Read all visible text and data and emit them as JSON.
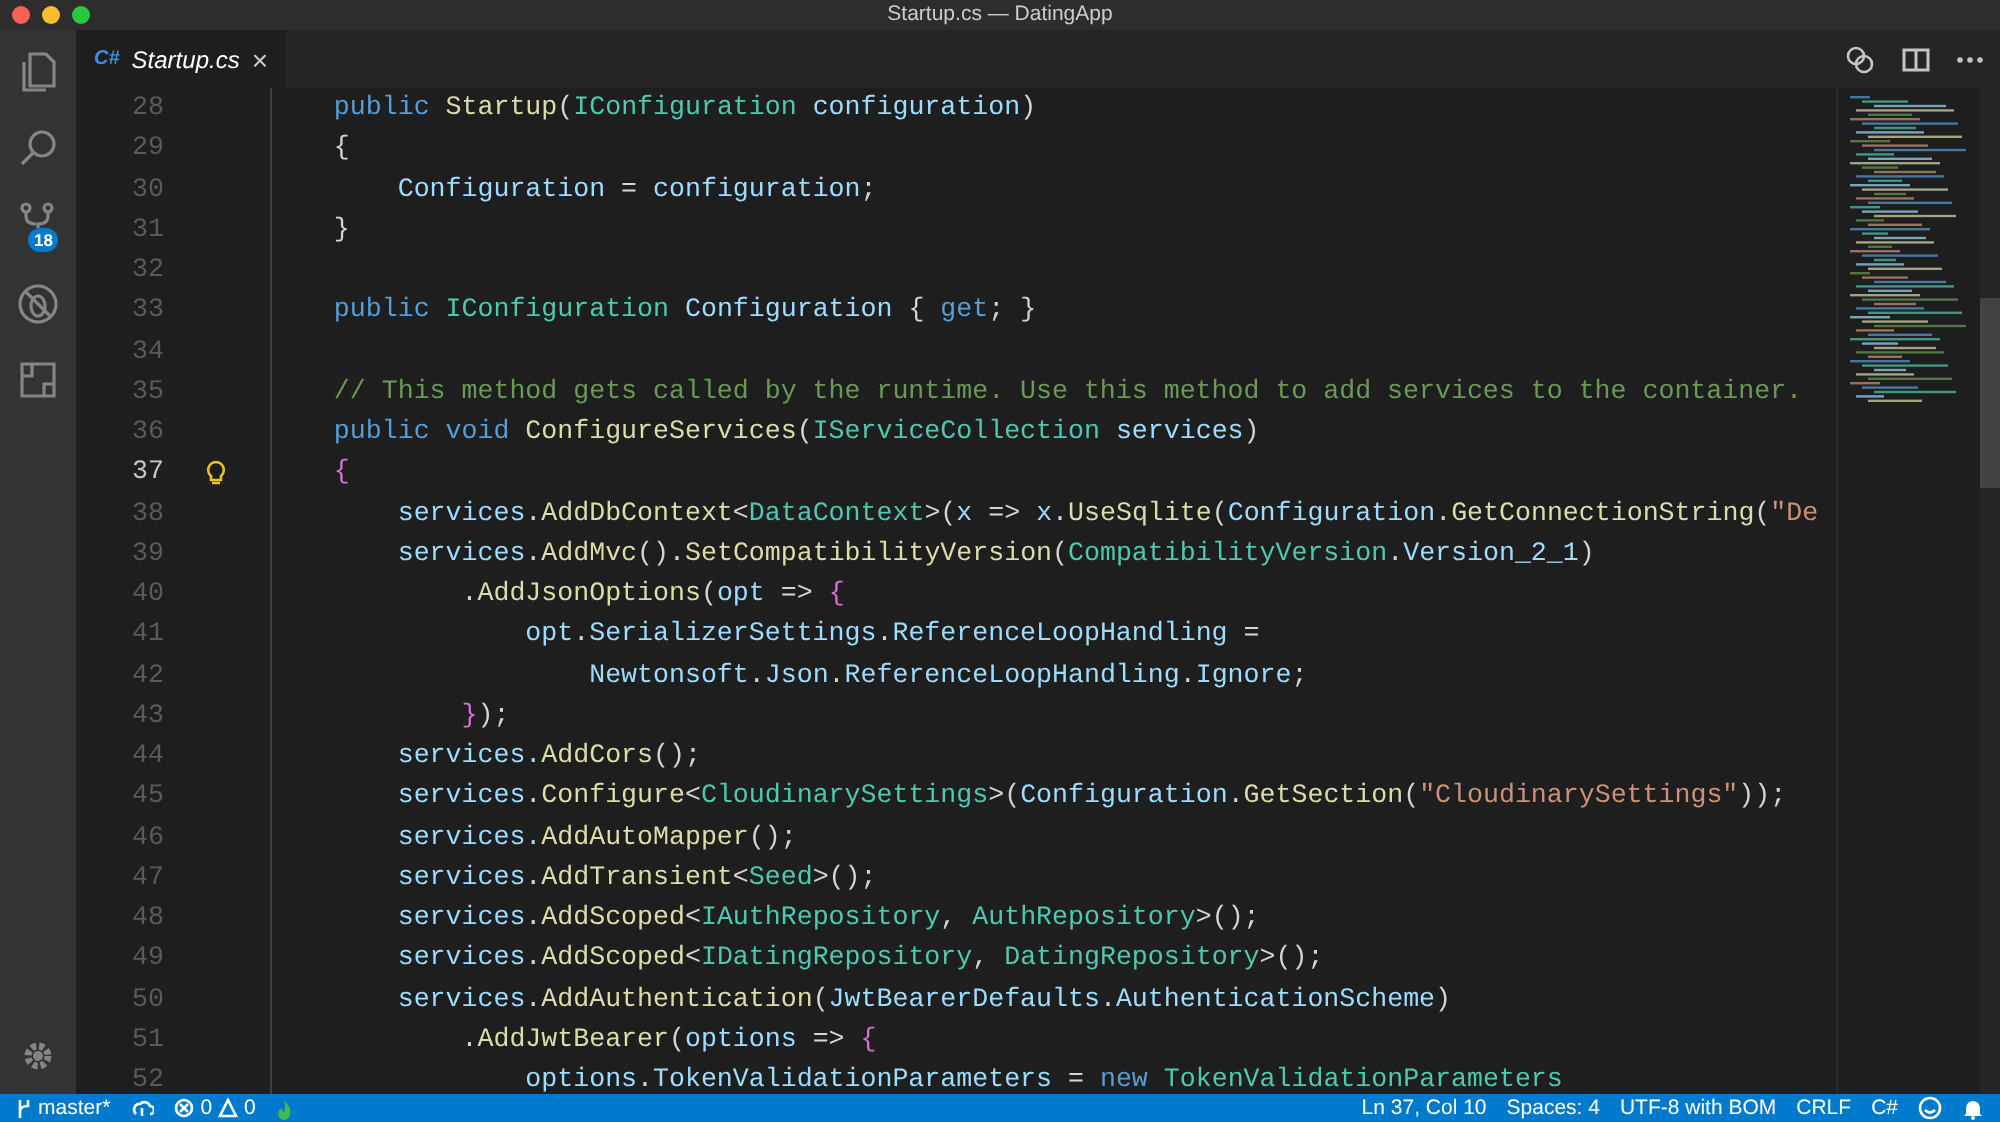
{
  "window": {
    "title": "Startup.cs — DatingApp"
  },
  "activity_bar": {
    "source_control_badge": "18"
  },
  "tabs": [
    {
      "icon_text": "C#",
      "label": "Startup.cs",
      "close": "×",
      "selected": true
    }
  ],
  "editor": {
    "lines": [
      {
        "number": "28",
        "current": false,
        "tokens": [
          {
            "kind": "kw",
            "text": "    public"
          },
          {
            "kind": "f",
            "text": " Startup"
          },
          {
            "kind": "p",
            "text": "("
          },
          {
            "kind": "t",
            "text": "IConfiguration"
          },
          {
            "kind": "v",
            "text": " configuration"
          },
          {
            "kind": "p",
            "text": ")"
          }
        ]
      },
      {
        "number": "29",
        "current": false,
        "tokens": [
          {
            "kind": "p",
            "text": "    {"
          }
        ]
      },
      {
        "number": "30",
        "current": false,
        "tokens": [
          {
            "kind": "v",
            "text": "        Configuration"
          },
          {
            "kind": "p",
            "text": " = "
          },
          {
            "kind": "v",
            "text": "configuration"
          },
          {
            "kind": "p",
            "text": ";"
          }
        ]
      },
      {
        "number": "31",
        "current": false,
        "tokens": [
          {
            "kind": "p",
            "text": "    }"
          }
        ]
      },
      {
        "number": "32",
        "current": false
      },
      {
        "number": "33",
        "current": false,
        "tokens": [
          {
            "kind": "kw",
            "text": "    public"
          },
          {
            "kind": "t",
            "text": " IConfiguration"
          },
          {
            "kind": "v",
            "text": " Configuration"
          },
          {
            "kind": "p",
            "text": " { "
          },
          {
            "kind": "kw",
            "text": "get"
          },
          {
            "kind": "p",
            "text": "; }"
          }
        ]
      },
      {
        "number": "34",
        "current": false
      },
      {
        "number": "35",
        "current": false,
        "tokens": [
          {
            "kind": "c",
            "text": "    // This method gets called by the runtime. Use this method to add services to the container."
          }
        ]
      },
      {
        "number": "36",
        "current": false,
        "tokens": [
          {
            "kind": "kw",
            "text": "    public"
          },
          {
            "kind": "kw",
            "text": " void"
          },
          {
            "kind": "f",
            "text": " ConfigureServices"
          },
          {
            "kind": "p",
            "text": "("
          },
          {
            "kind": "t",
            "text": "IServiceCollection"
          },
          {
            "kind": "v",
            "text": " services"
          },
          {
            "kind": "p",
            "text": ")"
          }
        ]
      },
      {
        "number": "37",
        "current": true,
        "tokens": [
          {
            "kind": "b",
            "text": "    {"
          }
        ]
      },
      {
        "number": "38",
        "current": false,
        "tokens": [
          {
            "kind": "v",
            "text": "        services"
          },
          {
            "kind": "p",
            "text": "."
          },
          {
            "kind": "f",
            "text": "AddDbContext"
          },
          {
            "kind": "p",
            "text": "<"
          },
          {
            "kind": "t",
            "text": "DataContext"
          },
          {
            "kind": "p",
            "text": ">("
          },
          {
            "kind": "v",
            "text": "x"
          },
          {
            "kind": "p",
            "text": " => "
          },
          {
            "kind": "v",
            "text": "x"
          },
          {
            "kind": "p",
            "text": "."
          },
          {
            "kind": "f",
            "text": "UseSqlite"
          },
          {
            "kind": "p",
            "text": "("
          },
          {
            "kind": "v",
            "text": "Configuration"
          },
          {
            "kind": "p",
            "text": "."
          },
          {
            "kind": "f",
            "text": "GetConnectionString"
          },
          {
            "kind": "p",
            "text": "("
          },
          {
            "kind": "s",
            "text": "\"De"
          }
        ]
      },
      {
        "number": "39",
        "current": false,
        "tokens": [
          {
            "kind": "v",
            "text": "        services"
          },
          {
            "kind": "p",
            "text": "."
          },
          {
            "kind": "f",
            "text": "AddMvc"
          },
          {
            "kind": "p",
            "text": "()."
          },
          {
            "kind": "f",
            "text": "SetCompatibilityVersion"
          },
          {
            "kind": "p",
            "text": "("
          },
          {
            "kind": "t",
            "text": "CompatibilityVersion"
          },
          {
            "kind": "p",
            "text": "."
          },
          {
            "kind": "v",
            "text": "Version_2_1"
          },
          {
            "kind": "p",
            "text": ")"
          }
        ]
      },
      {
        "number": "40",
        "current": false,
        "tokens": [
          {
            "kind": "p",
            "text": "            ."
          },
          {
            "kind": "f",
            "text": "AddJsonOptions"
          },
          {
            "kind": "p",
            "text": "("
          },
          {
            "kind": "v",
            "text": "opt"
          },
          {
            "kind": "p",
            "text": " => "
          },
          {
            "kind": "b",
            "text": "{"
          }
        ]
      },
      {
        "number": "41",
        "current": false,
        "tokens": [
          {
            "kind": "v",
            "text": "                opt"
          },
          {
            "kind": "p",
            "text": "."
          },
          {
            "kind": "v",
            "text": "SerializerSettings"
          },
          {
            "kind": "p",
            "text": "."
          },
          {
            "kind": "v",
            "text": "ReferenceLoopHandling"
          },
          {
            "kind": "p",
            "text": " ="
          }
        ]
      },
      {
        "number": "42",
        "current": false,
        "tokens": [
          {
            "kind": "v",
            "text": "                    Newtonsoft"
          },
          {
            "kind": "p",
            "text": "."
          },
          {
            "kind": "v",
            "text": "Json"
          },
          {
            "kind": "p",
            "text": "."
          },
          {
            "kind": "v",
            "text": "ReferenceLoopHandling"
          },
          {
            "kind": "p",
            "text": "."
          },
          {
            "kind": "v",
            "text": "Ignore"
          },
          {
            "kind": "p",
            "text": ";"
          }
        ]
      },
      {
        "number": "43",
        "current": false,
        "tokens": [
          {
            "kind": "b",
            "text": "            }"
          },
          {
            "kind": "p",
            "text": ");"
          }
        ]
      },
      {
        "number": "44",
        "current": false,
        "tokens": [
          {
            "kind": "v",
            "text": "        services."
          },
          {
            "kind": "f",
            "text": "AddCors"
          },
          {
            "kind": "p",
            "text": "();"
          }
        ]
      },
      {
        "number": "45",
        "current": false,
        "tokens": [
          {
            "kind": "v",
            "text": "        services"
          },
          {
            "kind": "p",
            "text": "."
          },
          {
            "kind": "f",
            "text": "Configure"
          },
          {
            "kind": "p",
            "text": "<"
          },
          {
            "kind": "t",
            "text": "CloudinarySettings"
          },
          {
            "kind": "p",
            "text": ">("
          },
          {
            "kind": "v",
            "text": "Configuration"
          },
          {
            "kind": "p",
            "text": "."
          },
          {
            "kind": "f",
            "text": "GetSection"
          },
          {
            "kind": "p",
            "text": "("
          },
          {
            "kind": "s",
            "text": "\"CloudinarySettings\""
          },
          {
            "kind": "p",
            "text": "));"
          }
        ]
      },
      {
        "number": "46",
        "current": false,
        "tokens": [
          {
            "kind": "v",
            "text": "        services."
          },
          {
            "kind": "f",
            "text": "AddAutoMapper"
          },
          {
            "kind": "p",
            "text": "();"
          }
        ]
      },
      {
        "number": "47",
        "current": false,
        "tokens": [
          {
            "kind": "v",
            "text": "        services"
          },
          {
            "kind": "p",
            "text": "."
          },
          {
            "kind": "f",
            "text": "AddTransient"
          },
          {
            "kind": "p",
            "text": "<"
          },
          {
            "kind": "t",
            "text": "Seed"
          },
          {
            "kind": "p",
            "text": ">();"
          }
        ]
      },
      {
        "number": "48",
        "current": false,
        "tokens": [
          {
            "kind": "v",
            "text": "        services"
          },
          {
            "kind": "p",
            "text": "."
          },
          {
            "kind": "f",
            "text": "AddScoped"
          },
          {
            "kind": "p",
            "text": "<"
          },
          {
            "kind": "t",
            "text": "IAuthRepository"
          },
          {
            "kind": "p",
            "text": ", "
          },
          {
            "kind": "t",
            "text": "AuthRepository"
          },
          {
            "kind": "p",
            "text": ">();"
          }
        ]
      },
      {
        "number": "49",
        "current": false,
        "tokens": [
          {
            "kind": "v",
            "text": "        services"
          },
          {
            "kind": "p",
            "text": "."
          },
          {
            "kind": "f",
            "text": "AddScoped"
          },
          {
            "kind": "p",
            "text": "<"
          },
          {
            "kind": "t",
            "text": "IDatingRepository"
          },
          {
            "kind": "p",
            "text": ", "
          },
          {
            "kind": "t",
            "text": "DatingRepository"
          },
          {
            "kind": "p",
            "text": ">();"
          }
        ]
      },
      {
        "number": "50",
        "current": false,
        "tokens": [
          {
            "kind": "v",
            "text": "        services"
          },
          {
            "kind": "p",
            "text": "."
          },
          {
            "kind": "f",
            "text": "AddAuthentication"
          },
          {
            "kind": "p",
            "text": "("
          },
          {
            "kind": "v",
            "text": "JwtBearerDefaults"
          },
          {
            "kind": "p",
            "text": "."
          },
          {
            "kind": "v",
            "text": "AuthenticationScheme"
          },
          {
            "kind": "p",
            "text": ")"
          }
        ]
      },
      {
        "number": "51",
        "current": false,
        "tokens": [
          {
            "kind": "p",
            "text": "            ."
          },
          {
            "kind": "f",
            "text": "AddJwtBearer"
          },
          {
            "kind": "p",
            "text": "("
          },
          {
            "kind": "v",
            "text": "options"
          },
          {
            "kind": "p",
            "text": " => "
          },
          {
            "kind": "b",
            "text": "{"
          }
        ]
      },
      {
        "number": "52",
        "current": false,
        "tokens": [
          {
            "kind": "v",
            "text": "                options"
          },
          {
            "kind": "p",
            "text": "."
          },
          {
            "kind": "v",
            "text": "TokenValidationParameters"
          },
          {
            "kind": "p",
            "text": " = "
          },
          {
            "kind": "kw",
            "text": "new"
          },
          {
            "kind": "t",
            "text": " TokenValidationParameters"
          }
        ]
      }
    ]
  },
  "status_bar": {
    "branch": "master*",
    "errors": "0",
    "warnings": "0",
    "cursor": "Ln 37, Col 10",
    "indentation": "Spaces: 4",
    "encoding": "UTF-8 with BOM",
    "line_ending": "CRLF",
    "language": "C#"
  }
}
